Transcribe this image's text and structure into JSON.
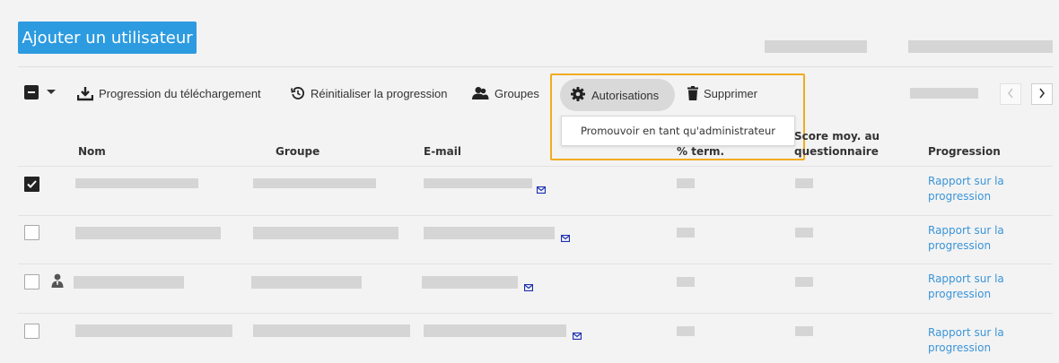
{
  "header": {
    "add_user_label": "Ajouter un utilisateur"
  },
  "toolbar": {
    "download_progress": "Progression du téléchargement",
    "reset_progress": "Réinitialiser la progression",
    "groups": "Groupes",
    "permissions": "Autorisations",
    "delete": "Supprimer"
  },
  "permissions_menu": {
    "promote_admin": "Promouvoir en tant qu'administrateur"
  },
  "table": {
    "headers": {
      "name": "Nom",
      "group": "Groupe",
      "email": "E-mail",
      "completion_line1": "",
      "completion_line2": "% term.",
      "score_line1": "Score moy. au",
      "score_line2": "questionnaire",
      "progress": "Progression"
    },
    "rows": [
      {
        "checked": true,
        "progress_link_line1": "Rapport sur la",
        "progress_link_line2": "progression"
      },
      {
        "checked": false,
        "progress_link_line1": "Rapport sur la",
        "progress_link_line2": "progression"
      },
      {
        "checked": false,
        "progress_link_line1": "Rapport sur la",
        "progress_link_line2": "progression"
      },
      {
        "checked": false,
        "progress_link_line1": "Rapport sur la",
        "progress_link_line2": "progression"
      }
    ]
  },
  "colors": {
    "accent": "#2d9be0",
    "highlight": "#f0ac1e",
    "link": "#3a95d8",
    "mail_icon": "#1a2fb0"
  },
  "icons": [
    "chevron-down-icon",
    "download-icon",
    "reset-history-icon",
    "groups-icon",
    "gear-icon",
    "trash-icon",
    "chevron-left-icon",
    "chevron-right-icon",
    "mail-icon",
    "admin-user-icon",
    "checkmark-icon"
  ]
}
